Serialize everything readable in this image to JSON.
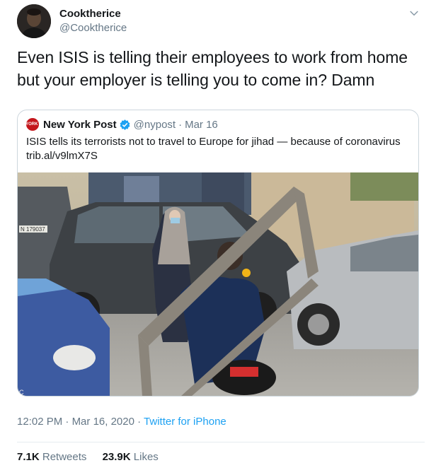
{
  "author": {
    "display_name": "Cooktherice",
    "handle": "@Cooktherice",
    "avatar_icon": "person-avatar"
  },
  "tweet": {
    "text": "Even ISIS is telling their employees to work from home but your employer is telling you to come in? Damn"
  },
  "quote": {
    "logo_text": "NEW YORK POST",
    "display_name": "New York Post",
    "verified_icon": "verified-badge-icon",
    "handle": "@nypost",
    "separator": "·",
    "date": "Mar 16",
    "text": "ISIS tells its terrorists not to travel to Europe for jihad — because of coronavirus trib.al/v9lmX7S",
    "photo_icon": "street-photo",
    "license_plate": "N 179037"
  },
  "meta": {
    "time": "12:02 PM",
    "separator": "·",
    "date": "Mar 16, 2020",
    "separator2": "·",
    "source": "Twitter for iPhone"
  },
  "stats": {
    "retweets_count": "7.1K",
    "retweets_label": "Retweets",
    "likes_count": "23.9K",
    "likes_label": "Likes"
  },
  "colors": {
    "text": "#14171a",
    "muted": "#657786",
    "link": "#1da1f2",
    "border": "#ccd6dd",
    "nypost_red": "#c4161c"
  }
}
